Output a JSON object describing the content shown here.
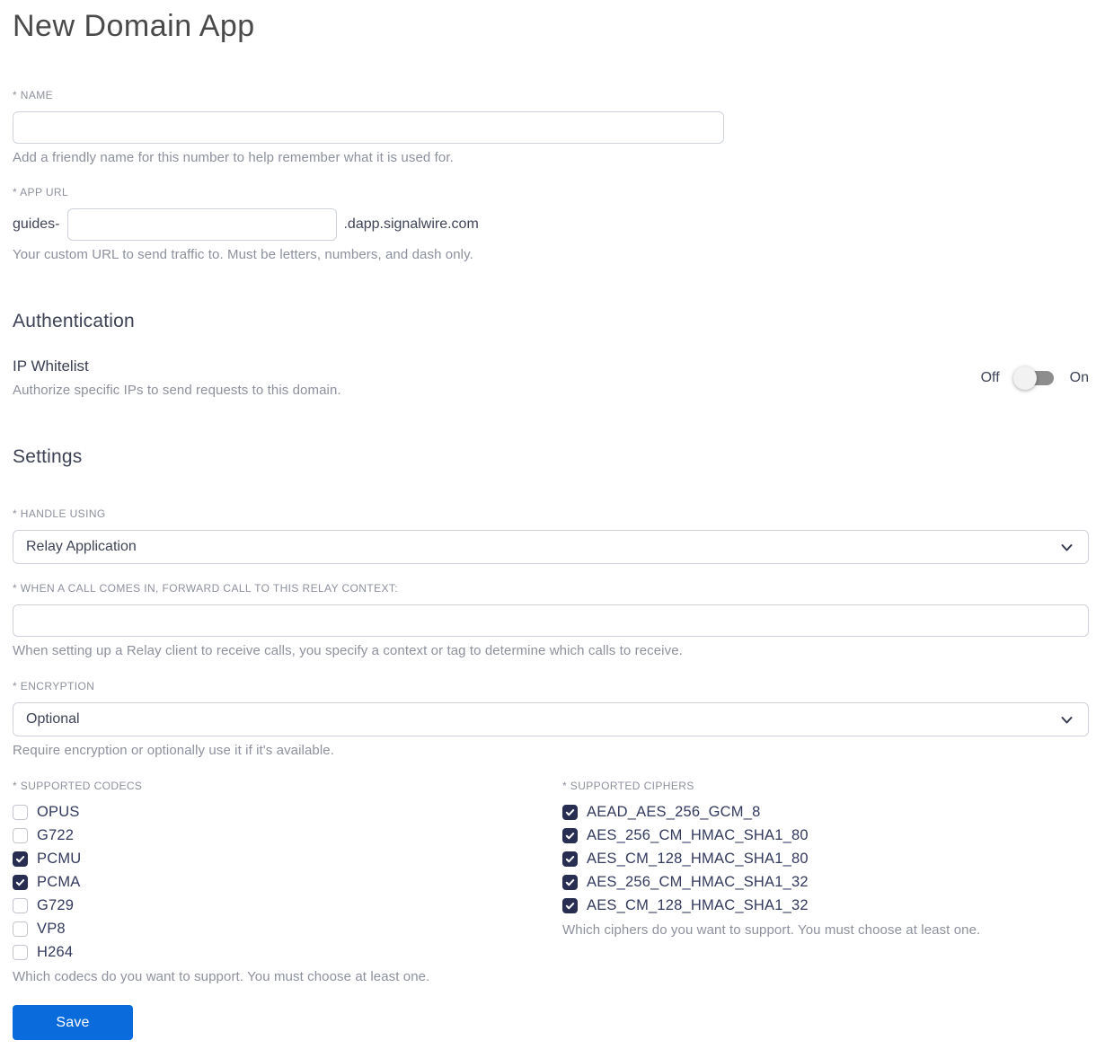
{
  "page": {
    "title": "New Domain App"
  },
  "name_field": {
    "label": "* NAME",
    "value": "",
    "help": "Add a friendly name for this number to help remember what it is used for."
  },
  "app_url_field": {
    "label": "* APP URL",
    "prefix": "guides-",
    "value": "",
    "suffix": ".dapp.signalwire.com",
    "help": "Your custom URL to send traffic to. Must be letters, numbers, and dash only."
  },
  "authentication": {
    "heading": "Authentication",
    "ip_whitelist": {
      "label": "IP Whitelist",
      "help": "Authorize specific IPs to send requests to this domain.",
      "off_label": "Off",
      "on_label": "On",
      "state": "off"
    }
  },
  "settings": {
    "heading": "Settings",
    "handle_using": {
      "label": "* HANDLE USING",
      "value": "Relay Application"
    },
    "relay_context": {
      "label": "* WHEN A CALL COMES IN, FORWARD CALL TO THIS RELAY CONTEXT:",
      "value": "",
      "help": "When setting up a Relay client to receive calls, you specify a context or tag to determine which calls to receive."
    },
    "encryption": {
      "label": "* ENCRYPTION",
      "value": "Optional",
      "help": "Require encryption or optionally use it if it's available."
    },
    "codecs": {
      "label": "* SUPPORTED CODECS",
      "help": "Which codecs do you want to support. You must choose at least one.",
      "options": [
        {
          "label": "OPUS",
          "checked": false
        },
        {
          "label": "G722",
          "checked": false
        },
        {
          "label": "PCMU",
          "checked": true
        },
        {
          "label": "PCMA",
          "checked": true
        },
        {
          "label": "G729",
          "checked": false
        },
        {
          "label": "VP8",
          "checked": false
        },
        {
          "label": "H264",
          "checked": false
        }
      ]
    },
    "ciphers": {
      "label": "* SUPPORTED CIPHERS",
      "help": "Which ciphers do you want to support. You must choose at least one.",
      "options": [
        {
          "label": "AEAD_AES_256_GCM_8",
          "checked": true
        },
        {
          "label": "AES_256_CM_HMAC_SHA1_80",
          "checked": true
        },
        {
          "label": "AES_CM_128_HMAC_SHA1_80",
          "checked": true
        },
        {
          "label": "AES_256_CM_HMAC_SHA1_32",
          "checked": true
        },
        {
          "label": "AES_CM_128_HMAC_SHA1_32",
          "checked": true
        }
      ]
    }
  },
  "actions": {
    "save_label": "Save"
  },
  "colors": {
    "accent_blue": "#0a6bdc",
    "checkbox_checked": "#272e52",
    "toggle_track": "#8d8d8d",
    "label_gray": "#8d919d",
    "body_text": "#3f4456"
  }
}
